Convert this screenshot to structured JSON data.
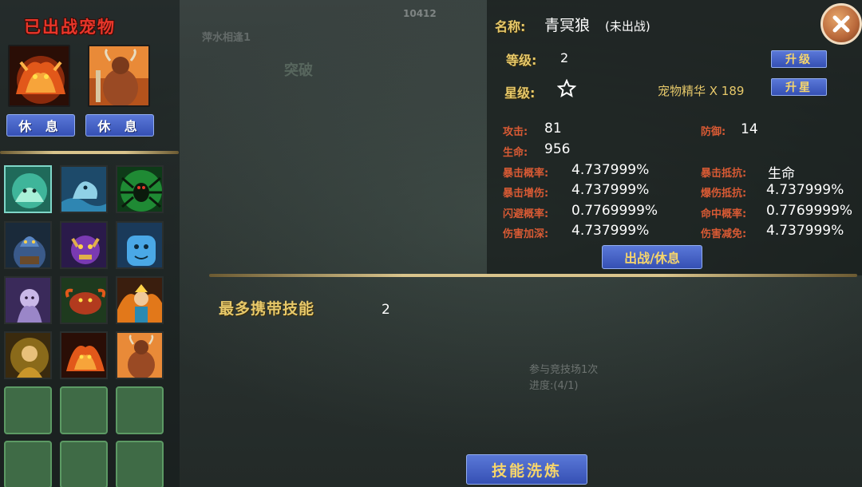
{
  "left_panel": {
    "title": "已出战宠物",
    "rest_label_1": "休 息",
    "rest_label_2": "休 息"
  },
  "detail": {
    "name_label": "名称:",
    "name_value": "青冥狼",
    "name_status": "(未出战)",
    "level_label": "等级:",
    "level_value": "2",
    "upgrade_button": "升级",
    "star_label": "星级:",
    "essence_text": "宠物精华 X 189",
    "star_up_button": "升星",
    "stats": {
      "attack_label": "攻击:",
      "attack_value": "81",
      "defense_label": "防御:",
      "defense_value": "14",
      "hp_label": "生命:",
      "hp_value": "956",
      "crit_rate_label": "暴击概率:",
      "crit_rate_value": "4.737999%",
      "crit_resist_label": "暴击抵抗:",
      "crit_resist_value": "生命",
      "crit_dmg_label": "暴击增伤:",
      "crit_dmg_value": "4.737999%",
      "crit_dmg_resist_label": "爆伤抵抗:",
      "crit_dmg_resist_value": "4.737999%",
      "dodge_label": "闪避概率:",
      "dodge_value": "0.7769999%",
      "hit_label": "命中概率:",
      "hit_value": "0.7769999%",
      "dmg_deepen_label": "伤害加深:",
      "dmg_deepen_value": "4.737999%",
      "dmg_reduce_label": "伤害减免:",
      "dmg_reduce_value": "4.737999%"
    },
    "deploy_rest_button": "出战/休息"
  },
  "skills": {
    "title": "最多携带技能",
    "count": "2",
    "refine_button": "技能洗炼"
  },
  "background_text": {
    "top_counter": "10412",
    "breakthrough": "突破",
    "side_text": "萍水相逢1",
    "quest_text": "参与竞技场1次",
    "quest_progress": "进度:(4/1)"
  },
  "colors": {
    "gold": "#e6c86a",
    "stat_red": "#d85a34",
    "title_red": "#e8362a",
    "button_blue": "#3550b4",
    "empty_slot_green": "#3f6b46"
  }
}
